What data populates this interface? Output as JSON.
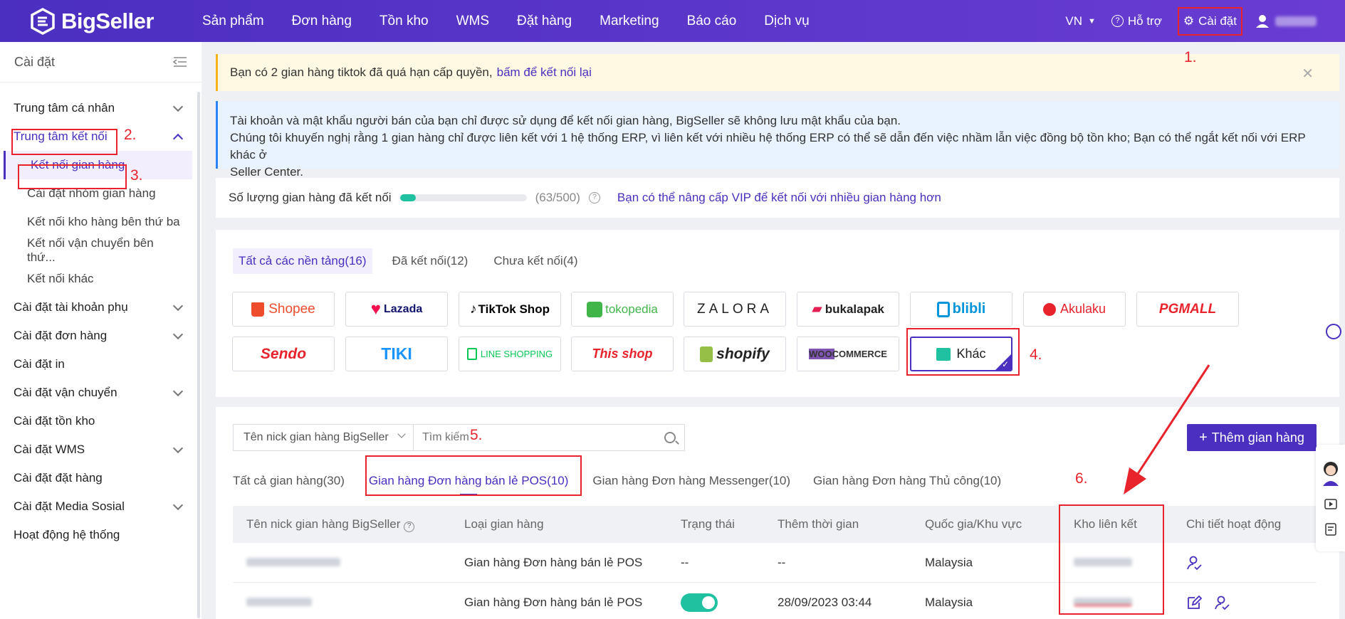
{
  "brand": {
    "name": "BigSeller"
  },
  "nav": {
    "items": [
      "Sản phẩm",
      "Đơn hàng",
      "Tồn kho",
      "WMS",
      "Đặt hàng",
      "Marketing",
      "Báo cáo",
      "Dịch vụ"
    ],
    "region": "VN",
    "support": "Hỗ trợ",
    "settings": "Cài đặt"
  },
  "annotations": {
    "step1": "1.",
    "step2": "2.",
    "step3": "3.",
    "step4": "4.",
    "step5": "5.",
    "step6": "6."
  },
  "sidebar": {
    "title": "Cài đặt",
    "items": [
      "Trung tâm cá nhân",
      "Trung tâm kết nối",
      "Kết nối gian hàng",
      "Cài đặt nhóm gian hàng",
      "Kết nối kho hàng bên thứ ba",
      "Kết nối vận chuyển bên thứ...",
      "Kết nối khác",
      "Cài đặt tài khoản phụ",
      "Cài đặt đơn hàng",
      "Cài đặt in",
      "Cài đặt vận chuyển",
      "Cài đặt tồn kho",
      "Cài đặt WMS",
      "Cài đặt đặt hàng",
      "Cài đặt Media Sosial",
      "Hoạt động hệ thống"
    ]
  },
  "notice_warning": {
    "text": "Bạn có 2 gian hàng tiktok đã quá hạn cấp quyền,",
    "link": "bấm để kết nối lại"
  },
  "notice_info": {
    "line1": "Tài khoản và mật khẩu người bán của bạn chỉ được sử dụng để kết nối gian hàng, BigSeller sẽ không lưu mật khẩu của bạn.",
    "line2": "Chúng tôi khuyến nghị rằng 1 gian hàng chỉ được liên kết với 1 hệ thống ERP, vì liên kết với nhiều hệ thống ERP có thể sẽ dẫn đến việc nhầm lẫn việc đồng bộ tồn kho; Bạn có thể ngắt kết nối với ERP khác ở",
    "line3": "Seller Center."
  },
  "quota": {
    "label": "Số lượng gian hàng đã kết nối",
    "used": 63,
    "total": 500,
    "text": "(63/500)",
    "upgrade": "Bạn có thể nâng cấp VIP để kết nối với nhiều gian hàng hơn"
  },
  "platform_tabs": [
    "Tất cả các nền tảng(16)",
    "Đã kết nối(12)",
    "Chưa kết nối(4)"
  ],
  "platforms": [
    "Shopee",
    "Lazada",
    "TikTok Shop",
    "tokopedia",
    "ZALORA",
    "bukalapak",
    "blibli",
    "Akulaku",
    "PGMALL",
    "Sendo",
    "TIKI",
    "LINE SHOPPING",
    "This shop",
    "shopify",
    "WOOCOMMERCE",
    "Khác"
  ],
  "filter": {
    "select": "Tên nick gian hàng BigSeller",
    "placeholder": "Tìm kiếm"
  },
  "add_button": "Thêm gian hàng",
  "store_tabs": [
    "Tất cả gian hàng(30)",
    "Gian hàng Đơn hàng bán lẻ POS(10)",
    "Gian hàng Đơn hàng Messenger(10)",
    "Gian hàng Đơn hàng Thủ công(10)"
  ],
  "table": {
    "headers": [
      "Tên nick gian hàng BigSeller",
      "Loại gian hàng",
      "Trạng thái",
      "Thêm thời gian",
      "Quốc gia/Khu vực",
      "Kho liên kết",
      "Chi tiết hoạt động"
    ],
    "rows": [
      {
        "type": "Gian hàng Đơn hàng bán lẻ POS",
        "status": "--",
        "time": "--",
        "country": "Malaysia"
      },
      {
        "type": "Gian hàng Đơn hàng bán lẻ POS",
        "status": "",
        "time": "28/09/2023 03:44",
        "country": "Malaysia"
      }
    ]
  },
  "colors": {
    "primary": "#4b2fc0",
    "annotation": "#e8232c",
    "toggle": "#1fc1a0"
  }
}
